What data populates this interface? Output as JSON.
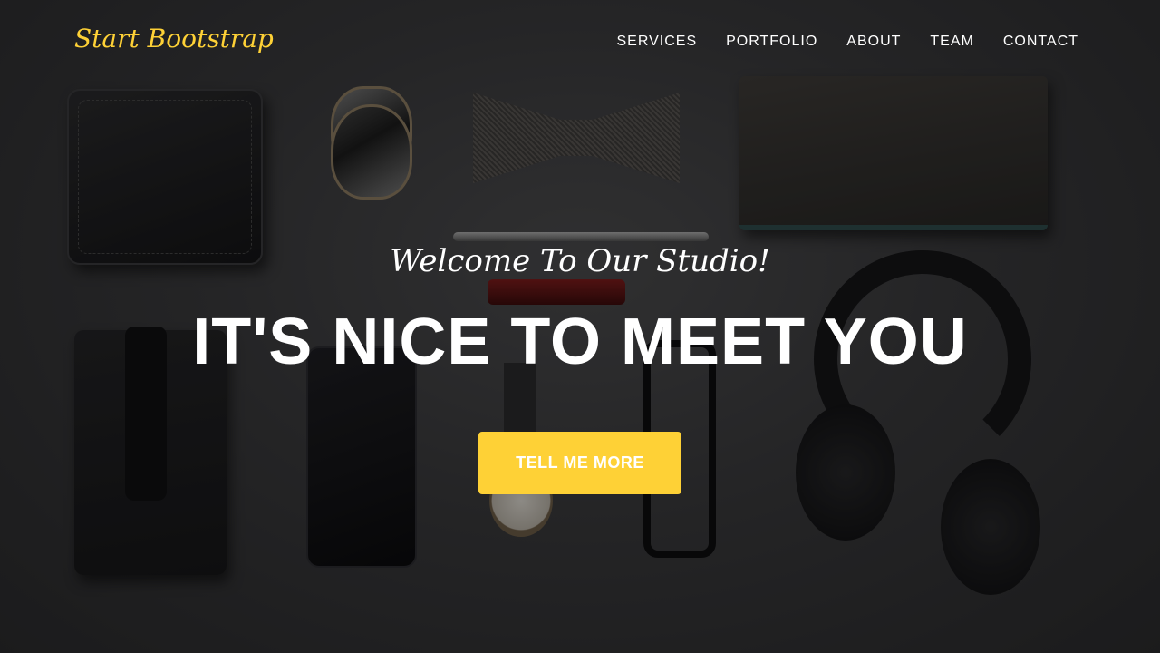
{
  "navbar": {
    "brand": "Start Bootstrap",
    "items": [
      {
        "label": "SERVICES"
      },
      {
        "label": "PORTFOLIO"
      },
      {
        "label": "ABOUT"
      },
      {
        "label": "TEAM"
      },
      {
        "label": "CONTACT"
      }
    ]
  },
  "hero": {
    "subheading": "Welcome To Our Studio!",
    "heading": "IT'S NICE TO MEET YOU",
    "cta_label": "TELL ME MORE"
  },
  "colors": {
    "accent": "#fed136",
    "text": "#ffffff",
    "background": "#2b2b2d"
  }
}
